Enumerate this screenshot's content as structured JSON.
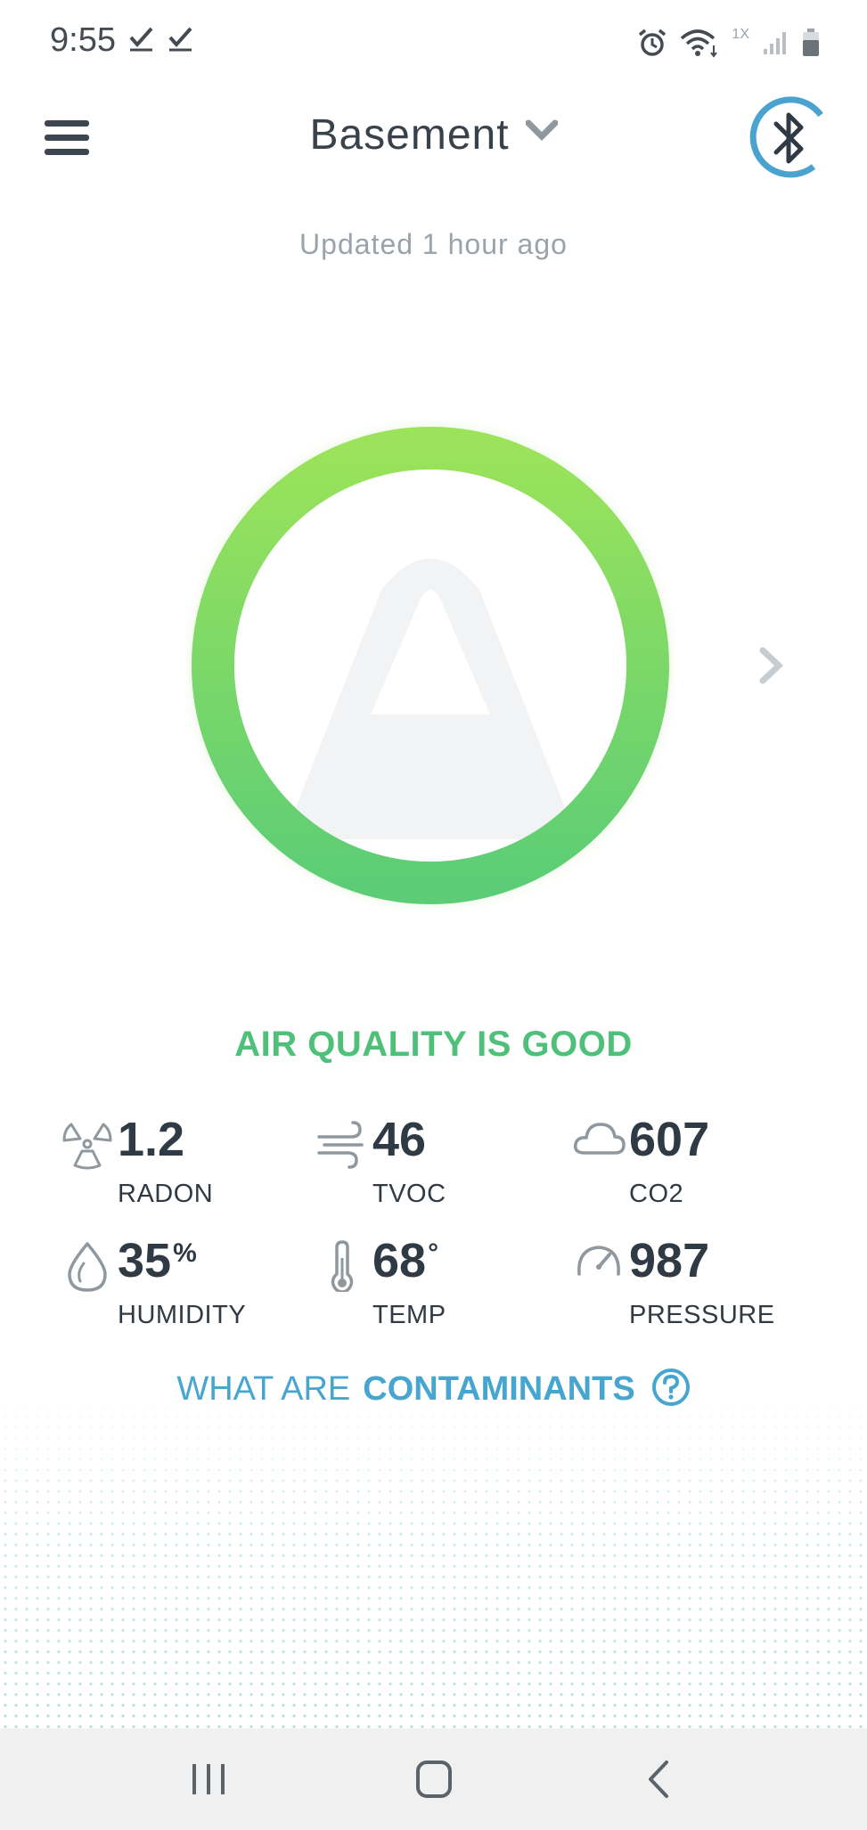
{
  "status_bar": {
    "time": "9:55",
    "network_label": "1X",
    "icons": [
      "check-icon",
      "check-icon",
      "alarm-icon",
      "wifi-icon",
      "signal-icon",
      "battery-icon"
    ]
  },
  "header": {
    "location": "Basement",
    "icons": [
      "menu-icon",
      "chevron-down-icon",
      "bluetooth-icon"
    ],
    "accent_color": "#4aa3cf"
  },
  "updated_text": "Updated 1 hour ago",
  "air_quality": {
    "status": "AIR QUALITY IS GOOD",
    "status_color": "#4fc07a",
    "ring_colors": [
      "#9be35a",
      "#5ccd76"
    ]
  },
  "metrics": [
    {
      "value": "1.2",
      "unit": "",
      "label": "RADON",
      "icon": "radiation-icon"
    },
    {
      "value": "46",
      "unit": "",
      "label": "TVOC",
      "icon": "wind-icon"
    },
    {
      "value": "607",
      "unit": "",
      "label": "CO2",
      "icon": "cloud-icon"
    },
    {
      "value": "35",
      "unit": "%",
      "label": "HUMIDITY",
      "icon": "water-drop-icon"
    },
    {
      "value": "68",
      "unit": "°",
      "label": "TEMP",
      "icon": "thermometer-icon"
    },
    {
      "value": "987",
      "unit": "",
      "label": "PRESSURE",
      "icon": "gauge-icon"
    }
  ],
  "contaminants_link": {
    "prefix": "WHAT ARE",
    "bold": "CONTAMINANTS",
    "icon": "help-circle-icon"
  },
  "nav_bar": {
    "icons": [
      "recent-apps-icon",
      "home-icon",
      "back-icon"
    ]
  }
}
